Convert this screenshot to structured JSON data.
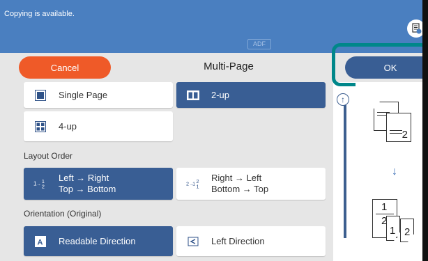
{
  "status": {
    "message": "Copying is available.",
    "adf_badge": "ADF"
  },
  "header": {
    "cancel_label": "Cancel",
    "title": "Multi-Page",
    "ok_label": "OK"
  },
  "layout": {
    "options": [
      {
        "label": "Single Page",
        "icon": "single-page-icon",
        "selected": false
      },
      {
        "label": "2-up",
        "icon": "two-up-icon",
        "selected": true
      },
      {
        "label": "4-up",
        "icon": "four-up-icon",
        "selected": false
      }
    ]
  },
  "layout_order": {
    "label": "Layout Order",
    "options": [
      {
        "line1": "Left → Right",
        "line2": "Top → Bottom",
        "icon": "left-right-top-bottom-icon",
        "selected": true
      },
      {
        "line1": "Right → Left",
        "line2": "Bottom → Top",
        "icon": "right-left-bottom-top-icon",
        "selected": false
      }
    ]
  },
  "orientation": {
    "label": "Orientation (Original)",
    "options": [
      {
        "label": "Readable Direction",
        "icon": "readable-direction-icon",
        "selected": true
      },
      {
        "label": "Left Direction",
        "icon": "left-direction-icon",
        "selected": false
      }
    ]
  },
  "preview": {
    "source_pages": [
      "1",
      "2"
    ],
    "result_pages": [
      "1",
      "2",
      "1",
      "2"
    ]
  },
  "colors": {
    "status_bar": "#4a7fc0",
    "cancel": "#ef5a28",
    "ok": "#395e94",
    "highlight": "#00878a",
    "selected_tile": "#395e94"
  }
}
